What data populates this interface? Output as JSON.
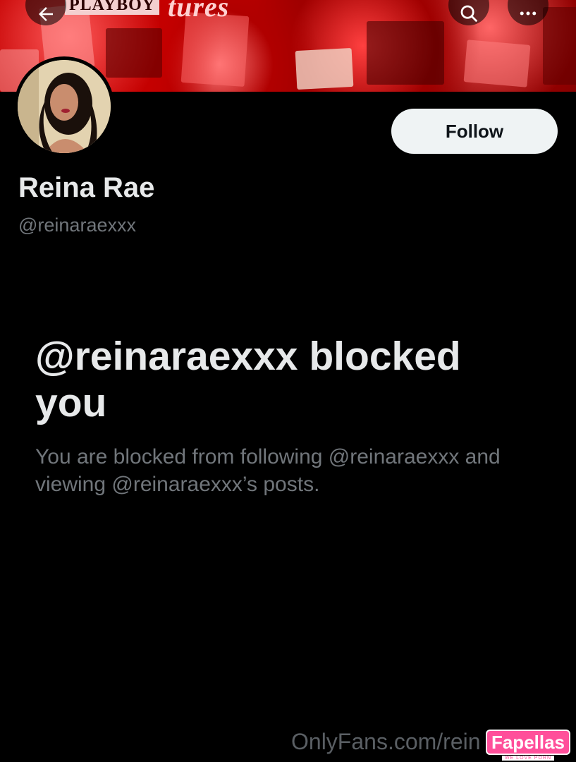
{
  "banner": {
    "collage_texts": [
      "PLAYBOY",
      "tures"
    ]
  },
  "nav": {
    "back_icon": "arrow-left-icon",
    "search_icon": "search-icon",
    "more_icon": "more-icon"
  },
  "profile": {
    "follow_label": "Follow",
    "display_name": "Reina Rae",
    "handle": "@reinaraexxx"
  },
  "blocked": {
    "title": "@reinaraexxx blocked you",
    "description": "You are blocked from following @reinaraexxx and viewing @reinaraexxx’s posts."
  },
  "watermark": {
    "text": "OnlyFans.com/rein",
    "logo_main": "Fapellas",
    "logo_sub": "WE LOVE PORN"
  },
  "colors": {
    "background": "#000000",
    "banner_red": "#e00000",
    "button_bg": "#eff3f4",
    "secondary_text": "#71767b",
    "logo_pink": "#ff4f9a"
  }
}
